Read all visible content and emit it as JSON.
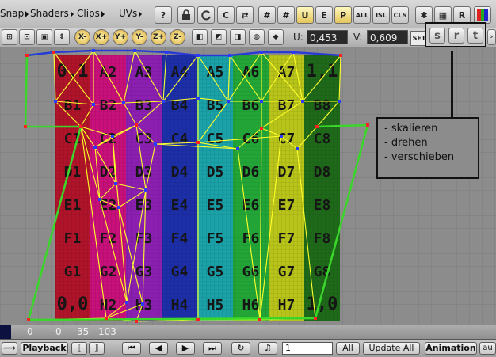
{
  "menu": {
    "snap": "Snap",
    "shaders": "Shaders",
    "clips": "Clips",
    "uvs": "UVs"
  },
  "toolbar": {
    "all": "ALL",
    "isl": "ISL",
    "cls": "CLS"
  },
  "uv": {
    "u_label": "U:",
    "u_value": "0,453",
    "v_label": "V:",
    "v_value": "0,609",
    "set_label": "SET"
  },
  "texture_grid": {
    "rows": [
      [
        "0,1",
        "A2",
        "A3",
        "A4",
        "A5",
        "A6",
        "A7",
        "1,1"
      ],
      [
        "B1",
        "B2",
        "B3",
        "B4",
        "B5",
        "B6",
        "B7",
        "B8"
      ],
      [
        "C1",
        "C2",
        "C3",
        "C4",
        "C5",
        "C6",
        "C7",
        "C8"
      ],
      [
        "D1",
        "D2",
        "D3",
        "D4",
        "D5",
        "D6",
        "D7",
        "D8"
      ],
      [
        "E1",
        "E2",
        "E3",
        "E4",
        "E5",
        "E6",
        "E7",
        "E8"
      ],
      [
        "F1",
        "F2",
        "F3",
        "F4",
        "F5",
        "F6",
        "F7",
        "F8"
      ],
      [
        "G1",
        "G2",
        "G3",
        "G4",
        "G5",
        "G6",
        "G7",
        "G8"
      ],
      [
        "0,0",
        "H2",
        "H3",
        "H4",
        "H5",
        "H6",
        "H7",
        "1,0"
      ]
    ],
    "colors": [
      "#b0142a",
      "#c8107a",
      "#8a1fb0",
      "#1d2fa8",
      "#1aa2a8",
      "#23a436",
      "#b8c41a",
      "#1f6a1a"
    ]
  },
  "annotation": {
    "lines": [
      "- skalieren",
      "- drehen",
      "- verschieben"
    ]
  },
  "transform_buttons": [
    "s",
    "r",
    "t"
  ],
  "status": {
    "values": [
      "0",
      "0",
      "35",
      "103"
    ]
  },
  "timeline": {
    "playback": "Playback",
    "frame_value": "1",
    "all": "All",
    "update_all": "Update All",
    "animation": "Animation",
    "au": "au"
  }
}
